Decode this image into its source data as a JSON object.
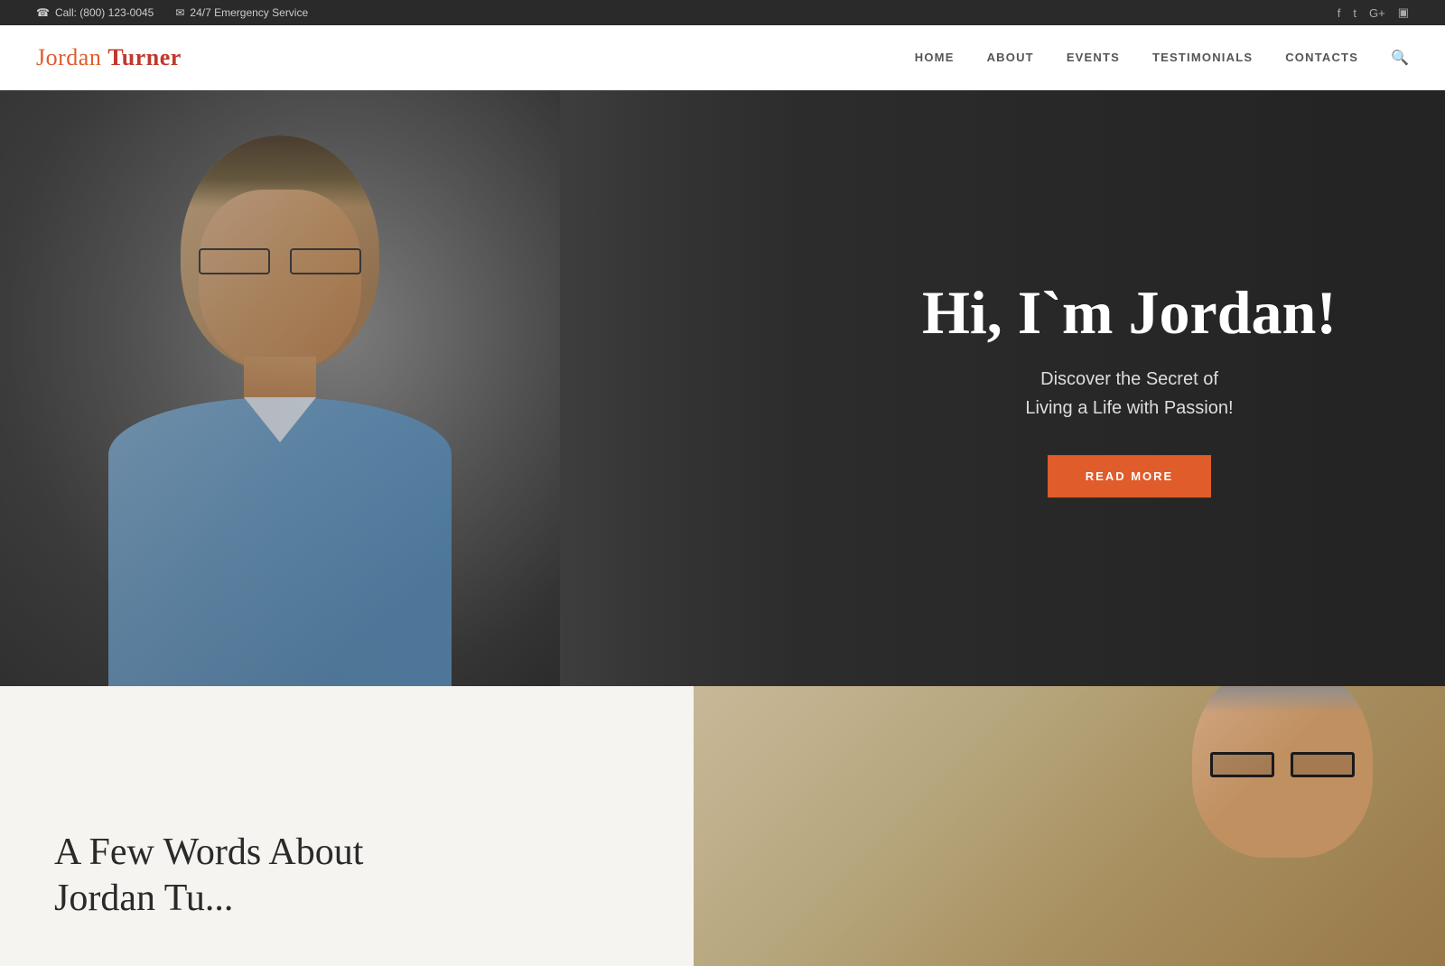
{
  "topbar": {
    "phone_icon": "☎",
    "phone_label": "Call: (800) 123-0045",
    "email_icon": "✉",
    "email_label": "24/7 Emergency Service",
    "social": {
      "facebook": "f",
      "twitter": "t",
      "googleplus": "G+",
      "instagram": "▣"
    }
  },
  "header": {
    "logo_first": "Jordan",
    "logo_last": "Turner",
    "nav": [
      {
        "label": "HOME",
        "id": "home"
      },
      {
        "label": "ABOUT",
        "id": "about"
      },
      {
        "label": "EVENTS",
        "id": "events"
      },
      {
        "label": "TESTIMONIALS",
        "id": "testimonials"
      },
      {
        "label": "CONTACTS",
        "id": "contacts"
      }
    ],
    "search_icon": "🔍"
  },
  "hero": {
    "title": "Hi, I`m Jordan!",
    "subtitle_line1": "Discover the Secret of",
    "subtitle_line2": "Living a Life with Passion!",
    "button_label": "READ MORE"
  },
  "below": {
    "title_line1": "A Few Words About",
    "title_line2": "Jordan Tu..."
  },
  "colors": {
    "accent": "#e05c2a",
    "dark_accent": "#c0392b",
    "dark_bg": "#2a2a2a",
    "hero_bg": "#3a3a3a"
  }
}
